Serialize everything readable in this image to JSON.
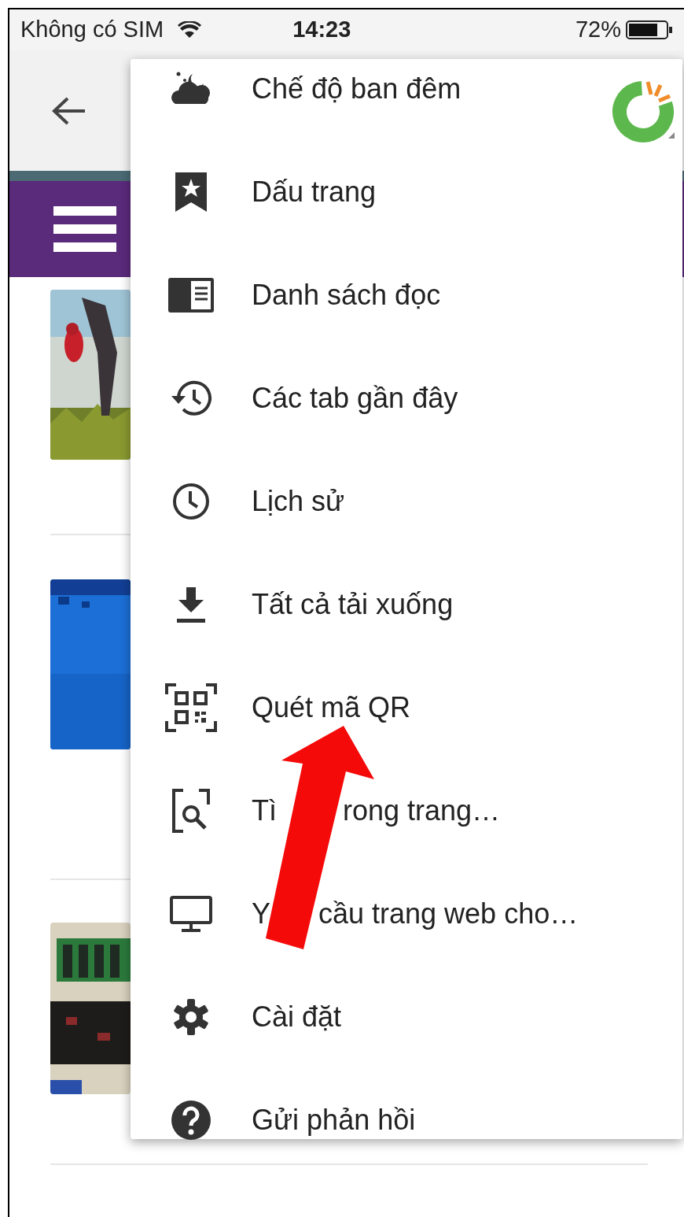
{
  "status_bar": {
    "carrier": "Không có SIM",
    "time": "14:23",
    "battery": "72%"
  },
  "menu": {
    "items": [
      {
        "label": "Chế độ ban đêm"
      },
      {
        "label": "Dấu trang"
      },
      {
        "label": "Danh sách đọc"
      },
      {
        "label": "Các tab gần đây"
      },
      {
        "label": "Lịch sử"
      },
      {
        "label": "Tất cả tải xuống"
      },
      {
        "label": "Quét mã QR"
      },
      {
        "parts": [
          "Tì",
          "rong trang…"
        ]
      },
      {
        "parts": [
          "Y",
          "cầu trang web cho…"
        ]
      },
      {
        "label": "Cài đặt"
      },
      {
        "label": "Gửi phản hồi"
      }
    ]
  }
}
